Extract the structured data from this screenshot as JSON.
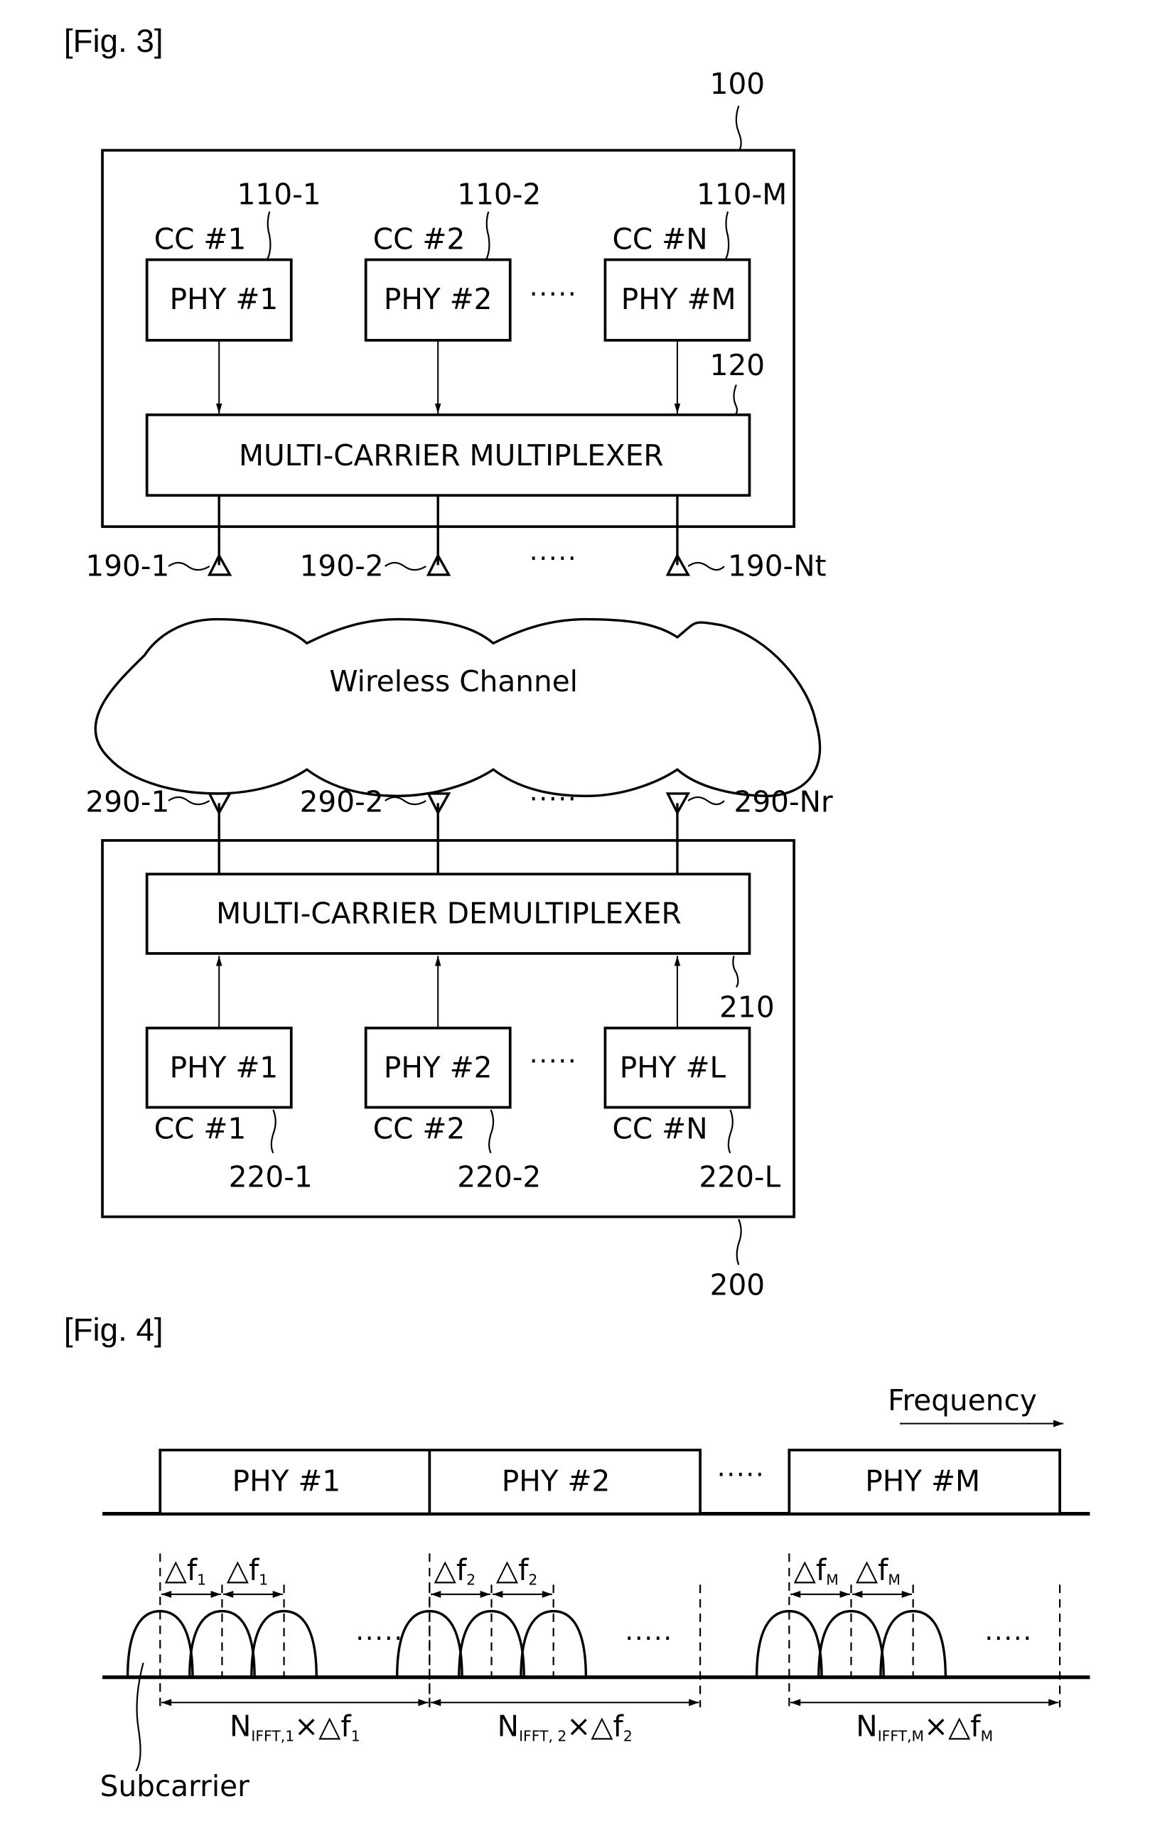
{
  "figures": [
    {
      "title": "[Fig. 3]",
      "transmitter": {
        "ref": "100",
        "phy_blocks": [
          {
            "ref": "110-1",
            "cc": "CC #1",
            "label": "PHY #1"
          },
          {
            "ref": "110-2",
            "cc": "CC #2",
            "label": "PHY #2"
          },
          {
            "ref": "110-M",
            "cc": "CC #N",
            "label": "PHY #M"
          }
        ],
        "ellipsis": "·····",
        "multiplexer": {
          "ref": "120",
          "label": "MULTI-CARRIER MULTIPLEXER"
        },
        "antennas": [
          "190-1",
          "190-2",
          "190-Nt"
        ]
      },
      "channel": {
        "label": "Wireless Channel"
      },
      "receiver": {
        "ref": "200",
        "antennas": [
          "290-1",
          "290-2",
          "290-Nr"
        ],
        "demultiplexer": {
          "ref": "210",
          "label": "MULTI-CARRIER DEMULTIPLEXER"
        },
        "phy_blocks": [
          {
            "ref": "220-1",
            "cc": "CC #1",
            "label": "PHY #1"
          },
          {
            "ref": "220-2",
            "cc": "CC #2",
            "label": "PHY #2"
          },
          {
            "ref": "220-L",
            "cc": "CC #N",
            "label": "PHY #L"
          }
        ],
        "ellipsis": "·····"
      }
    },
    {
      "title": "[Fig. 4]",
      "axis_label": "Frequency",
      "bands": [
        "PHY #1",
        "PHY #2",
        "PHY #M"
      ],
      "ellipsis": "·····",
      "spacings": [
        {
          "delta": "△f",
          "sub": "1"
        },
        {
          "delta": "△f",
          "sub": "2"
        },
        {
          "delta": "△f",
          "sub": "M"
        }
      ],
      "bandwidths": [
        {
          "n": "N",
          "n_sub": "IFFT,1",
          "times": "×",
          "delta": "△f",
          "sub": "1"
        },
        {
          "n": "N",
          "n_sub": "IFFT, 2",
          "times": "×",
          "delta": "△f",
          "sub": "2"
        },
        {
          "n": "N",
          "n_sub": "IFFT,M",
          "times": "×",
          "delta": "△f",
          "sub": "M"
        }
      ],
      "subcarrier_label": "Subcarrier"
    }
  ]
}
